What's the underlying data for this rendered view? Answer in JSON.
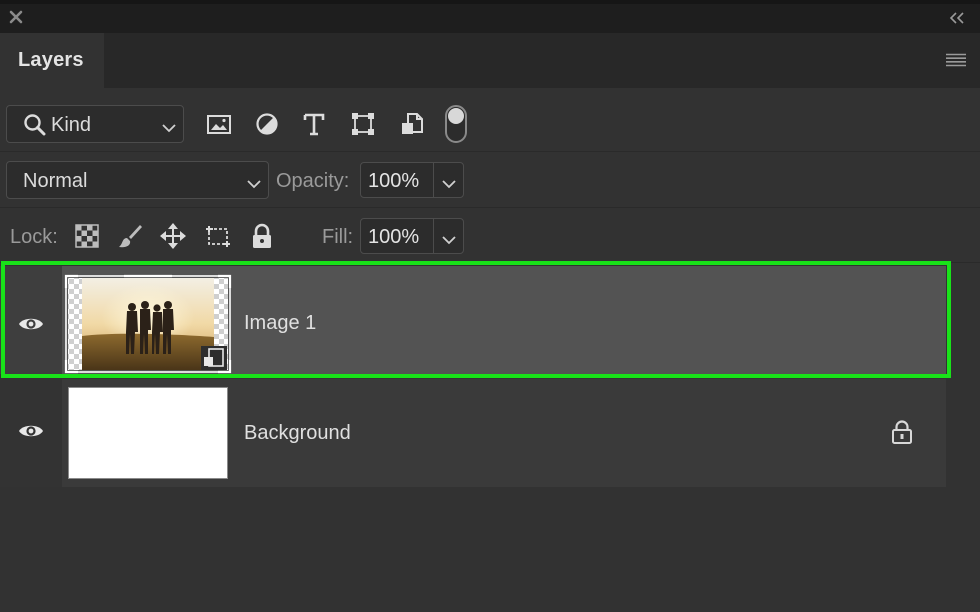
{
  "panel": {
    "tab_label": "Layers"
  },
  "filter": {
    "kind_label": "Kind",
    "icons": [
      "image-filter-icon",
      "adjustment-filter-icon",
      "type-filter-icon",
      "shape-filter-icon",
      "smart-object-filter-icon"
    ]
  },
  "blend": {
    "mode": "Normal",
    "opacity_label": "Opacity:",
    "opacity_value": "100%"
  },
  "lock": {
    "label": "Lock:",
    "icons": [
      "lock-transparent-pixels-icon",
      "lock-image-pixels-icon",
      "lock-position-icon",
      "lock-artboard-icon",
      "lock-all-icon"
    ],
    "fill_label": "Fill:",
    "fill_value": "100%"
  },
  "layers": [
    {
      "name": "Image 1",
      "selected": true,
      "visible": true,
      "locked": false,
      "smart_object": true
    },
    {
      "name": "Background",
      "selected": false,
      "visible": true,
      "locked": true,
      "smart_object": false
    }
  ],
  "colors": {
    "selection_highlight": "#19e219",
    "panel_bg": "#323232",
    "selected_row": "#535353"
  }
}
